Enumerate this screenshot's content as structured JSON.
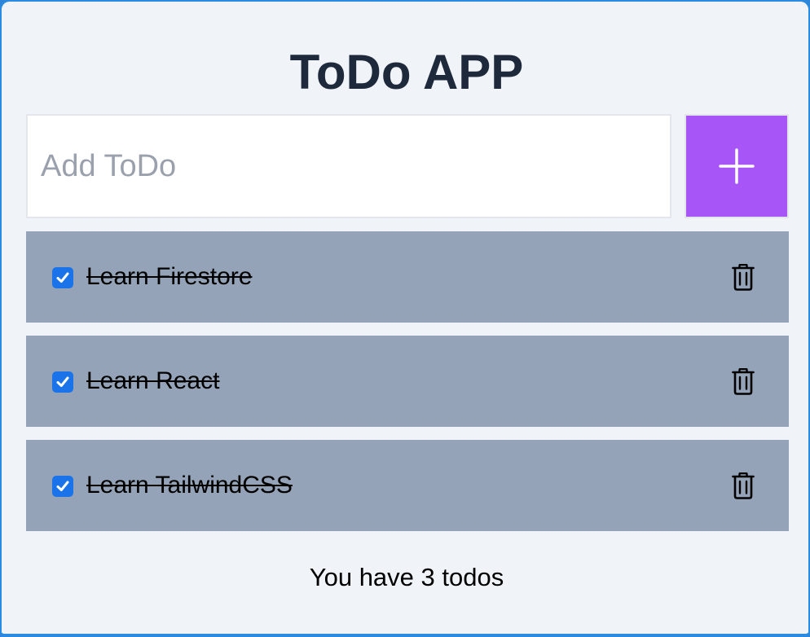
{
  "app": {
    "title": "ToDo APP"
  },
  "add_form": {
    "input_value": "",
    "input_placeholder": "Add ToDo",
    "add_button_icon": "plus-icon",
    "accent_color": "#a855f7"
  },
  "todos": [
    {
      "text": "Learn Firestore",
      "completed": true,
      "delete_icon": "trash-icon"
    },
    {
      "text": "Learn React",
      "completed": true,
      "delete_icon": "trash-icon"
    },
    {
      "text": "Learn TailwindCSS",
      "completed": true,
      "delete_icon": "trash-icon"
    }
  ],
  "colors": {
    "background": "#f0f3f8",
    "item_background": "#94a3b8",
    "title": "#1e293b",
    "checkbox": "#1a73e8"
  },
  "footer": {
    "count_text": "You have 3 todos"
  }
}
